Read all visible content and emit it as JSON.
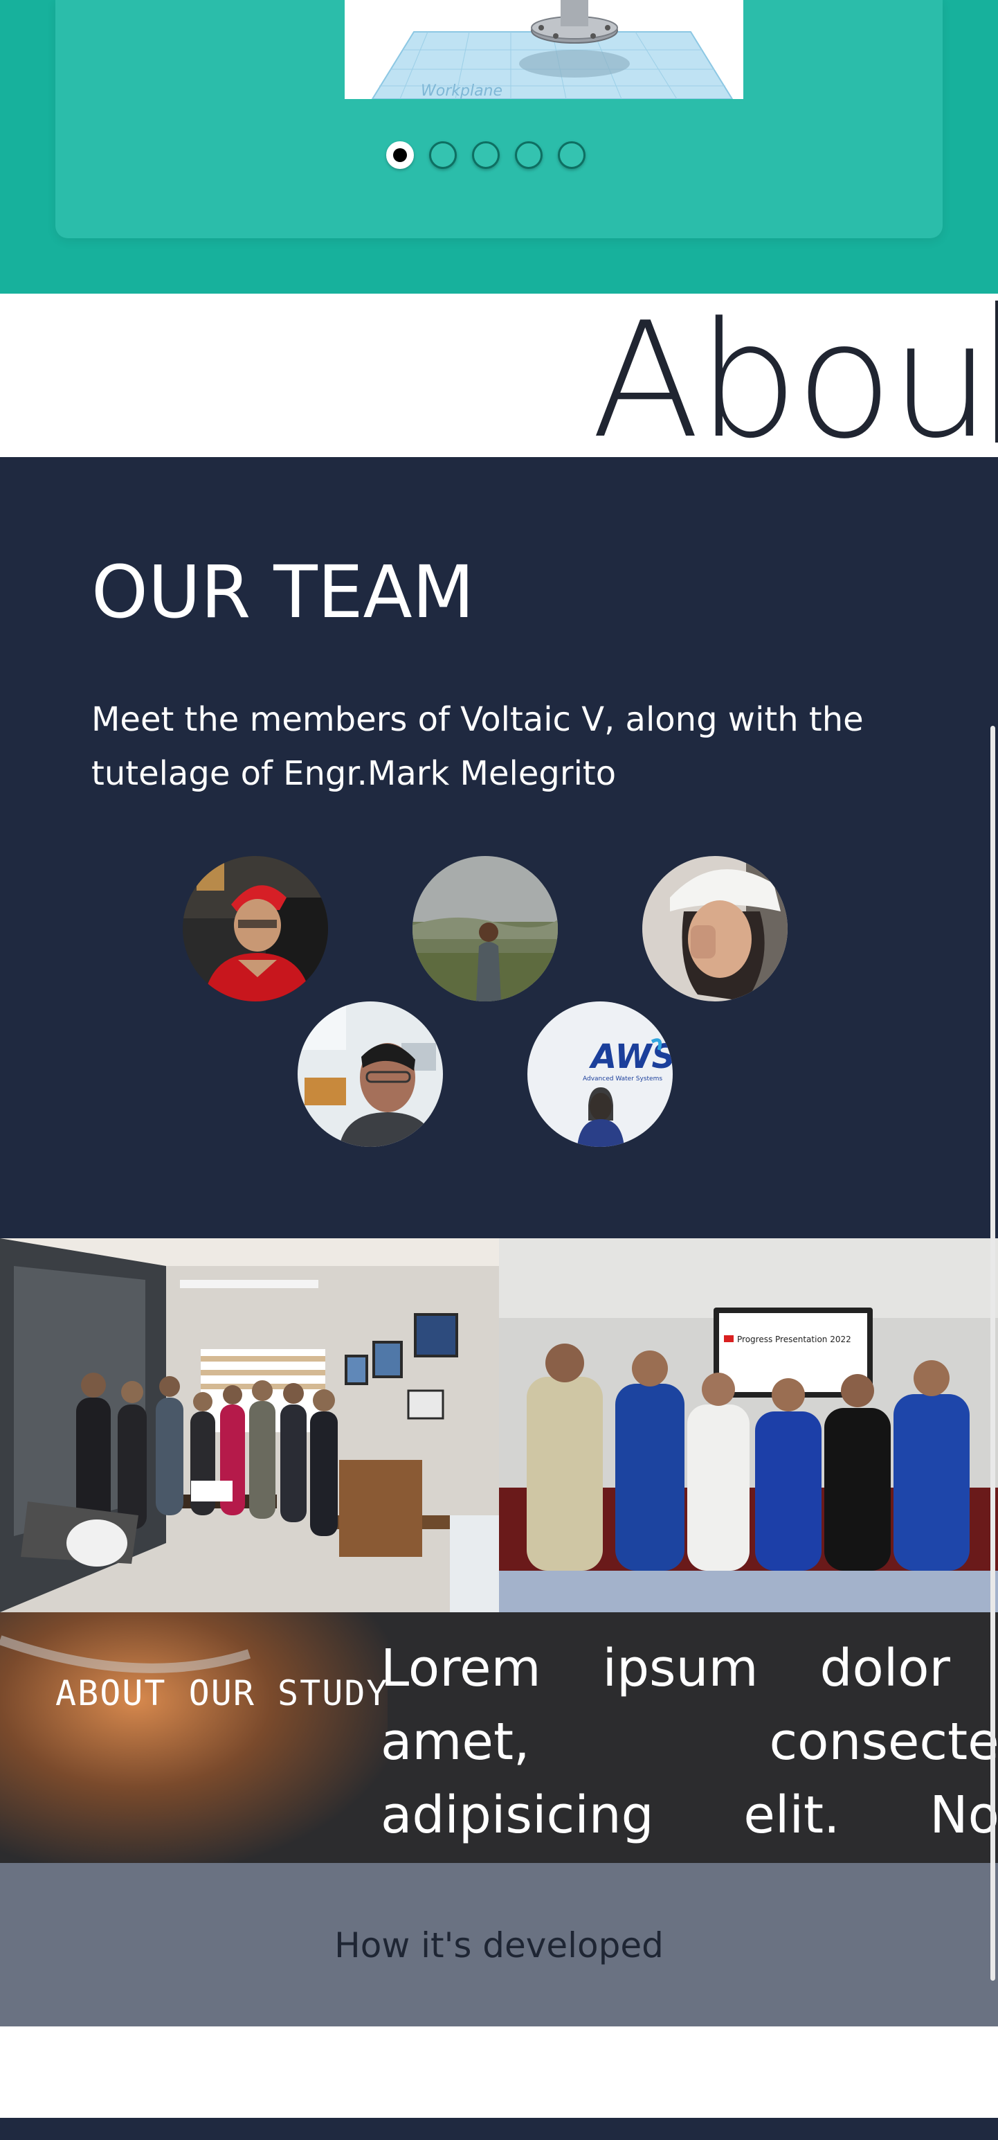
{
  "carousel": {
    "slide_watermark": "Workplane",
    "dots": [
      {
        "label": "slide 1",
        "active": true
      },
      {
        "label": "slide 2",
        "active": false
      },
      {
        "label": "slide 3",
        "active": false
      },
      {
        "label": "slide 4",
        "active": false
      },
      {
        "label": "slide 5",
        "active": false
      }
    ]
  },
  "about": {
    "heading": "Abou"
  },
  "team": {
    "title": "OUR TEAM",
    "description": "Meet the members of Voltaic V, along with the tutelage of Engr.Mark Melegrito",
    "members": [
      "member 1",
      "member 2",
      "member 3",
      "member 4",
      "member 5"
    ],
    "aws_logo_text": "AWS",
    "aws_logo_subtext": "Advanced Water Systems"
  },
  "photos": {
    "presentation_screen_title": "Progress Presentation 2022"
  },
  "study": {
    "title": "ABOUT OUR STUDY",
    "text": "Lorem ipsum dolor sit amet, consectetur adipisicing elit. Nobis autem quisquam ducimus"
  },
  "developed": {
    "label": "How it's developed"
  },
  "colors": {
    "teal": "#17b19c",
    "navy": "#1f2940",
    "slate": "#6a7282"
  }
}
